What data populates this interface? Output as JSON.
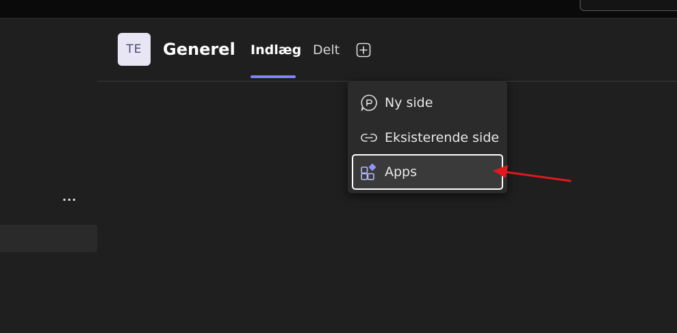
{
  "header": {
    "avatar_initials": "TE",
    "channel_title": "Generel",
    "tabs": [
      {
        "label": "Indlæg",
        "active": true
      },
      {
        "label": "Delt",
        "active": false
      }
    ],
    "add_tab_icon": "plus-square-icon"
  },
  "sidebar": {
    "more_label": "..."
  },
  "add_tab_menu": {
    "items": [
      {
        "label": "Ny side",
        "icon": "page-chat-icon"
      },
      {
        "label": "Eksisterende side",
        "icon": "link-icon"
      },
      {
        "label": "Apps",
        "icon": "apps-icon",
        "highlighted": true
      }
    ]
  },
  "colors": {
    "accent": "#7f85f5",
    "background": "#1f1f1f",
    "menu_background": "#2b2b2b",
    "annotation_arrow": "#e0191f"
  }
}
